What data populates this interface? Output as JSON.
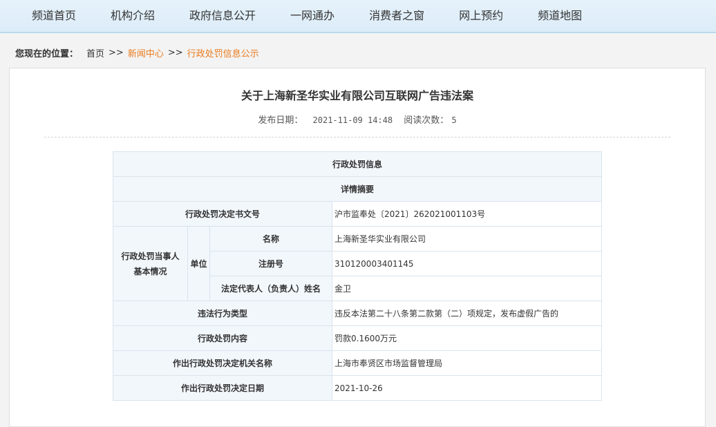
{
  "nav": {
    "items": [
      "频道首页",
      "机构介绍",
      "政府信息公开",
      "一网通办",
      "消费者之窗",
      "网上预约",
      "频道地图"
    ]
  },
  "breadcrumb": {
    "label": "您现在的位置：",
    "home": "首页",
    "sep": ">>",
    "news": "新闻中心",
    "current": "行政处罚信息公示"
  },
  "article": {
    "title": "关于上海新圣华实业有限公司互联网广告违法案",
    "publish_label": "发布日期：",
    "publish_date": "2021-11-09 14:48",
    "read_label": "阅读次数：",
    "read_count": "5"
  },
  "table": {
    "header1": "行政处罚信息",
    "header2": "详情摘要",
    "doc_no_label": "行政处罚决定书文号",
    "doc_no": "沪市监奉处〔2021〕262021001103号",
    "party_label_l1": "行政处罚当事人",
    "party_label_l2": "基本情况",
    "unit_label": "单位",
    "name_label": "名称",
    "name_value": "上海新圣华实业有限公司",
    "reg_label": "注册号",
    "reg_value": "310120003401145",
    "rep_label": "法定代表人（负责人）姓名",
    "rep_value": "金卫",
    "violation_label": "违法行为类型",
    "violation_value": "违反本法第二十八条第二款第（二）项规定，发布虚假广告的",
    "content_label": "行政处罚内容",
    "content_value": "罚款0.1600万元",
    "authority_label": "作出行政处罚决定机关名称",
    "authority_value": "上海市奉贤区市场监督管理局",
    "date_label": "作出行政处罚决定日期",
    "date_value": "2021-10-26"
  },
  "colors": {
    "accent": "#ea7b1e",
    "nav_bg": "#dcecf8",
    "header_cell": "#f2f7fc",
    "border": "#d9e3ec"
  }
}
